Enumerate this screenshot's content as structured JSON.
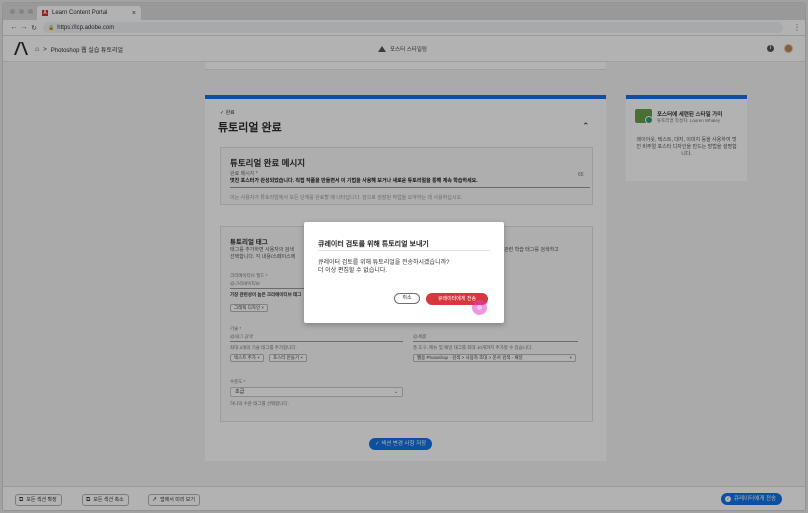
{
  "browser": {
    "tab_title": "Learn Content Portal",
    "favicon": "A",
    "url": "https://lcp.adobe.com"
  },
  "header": {
    "breadcrumb_sep": ">",
    "breadcrumb_page": "Photoshop 웹 실습 튜토리얼",
    "center_label": "포스터 스타일링",
    "help_glyph": "i"
  },
  "card": {
    "status": "✓ 완료",
    "title": "튜토리얼 완료",
    "section1": {
      "heading": "튜토리얼 완료 메시지",
      "label": "완료 메시지 *",
      "value": "멋진 포스터가 완성되었습니다. 직접 작품을 만들면서 이 기법을 사용해 보거나 새로운 튜토리얼을 통해 계속 학습하세요.",
      "count": "65",
      "help": "이는 사용자가 튜토리얼에서 모든 단계를 완료할 때 나타납니다. 앞으로 권장된 작업을 요약하는 데 사용하십시오."
    },
    "section2": {
      "heading": "튜토리얼 태그",
      "desc_line1": "태그를 추가하면 사용자의 검색",
      "desc_right": "관련 학습 태그를 검색하고",
      "desc_line2": "선택합니다. 각 내용/스페이스에",
      "creative_label": "크리에이티브 필드 *",
      "creative_sub": "@크리에이티브",
      "creative_bold": "가장 관련성이 높은 크리에이티브 태그",
      "chip_graphic": "그래픽 디자인",
      "skill_label": "기술 *",
      "skill_sub": "@태그 검색",
      "skill_hint": "최대 3개의 기술 태그를 추가합니다.",
      "chip_text": "텍스트 추가",
      "chip_poster": "포스터 만들기",
      "product_sub": "@제품",
      "product_hint": "총 도구, 메뉴 및 패널 태그를 최대 10개까지 추가할 수 있습니다.",
      "chip_product": "웹용 Photoshop - 검색 > 사용자 조대 > 문서 검색 - 패널",
      "level_label": "수준도 *",
      "level_value": "초급",
      "level_hint": "하나의 수준 태그를 선택합니다."
    },
    "save_button": "섹션 변경 사항 저장"
  },
  "side_card": {
    "title": "포스터에 세련된 스타일 가미",
    "author": "튜토리얼 작성자: Lauren Whaley",
    "body": "레이아웃, 텍스트, 대지, 이미지 등을 사용하여 멋진 비주얼 포스터 디자인을 만드는 방법을 설명합니다."
  },
  "bottom": {
    "expand_all": "모든 섹션 확장",
    "collapse_all": "모든 섹션 축소",
    "preview_in_app": "앱에서 미리 보기",
    "submit": "큐레이터에게 전송"
  },
  "dialog": {
    "title": "큐레이터 검토를 위해 튜토리얼 보내기",
    "line1": "큐레이터 검토를 위해 튜토리얼을 전송하시겠습니까?",
    "line2": "더 이상 편집할 수 없습니다.",
    "cancel": "취소",
    "send": "큐레이터에게 전송"
  },
  "colors": {
    "accent": "#1473e6",
    "danger": "#d7373f",
    "overlay": "rgba(0,0,0,0.30)"
  },
  "icons": [
    "back-icon",
    "forward-icon",
    "reload-icon",
    "lock-icon",
    "home-icon",
    "poster-icon",
    "help-icon",
    "check-icon",
    "chevron-up-icon",
    "expand-icon",
    "collapse-icon",
    "external-link-icon",
    "cursor-indicator"
  ]
}
